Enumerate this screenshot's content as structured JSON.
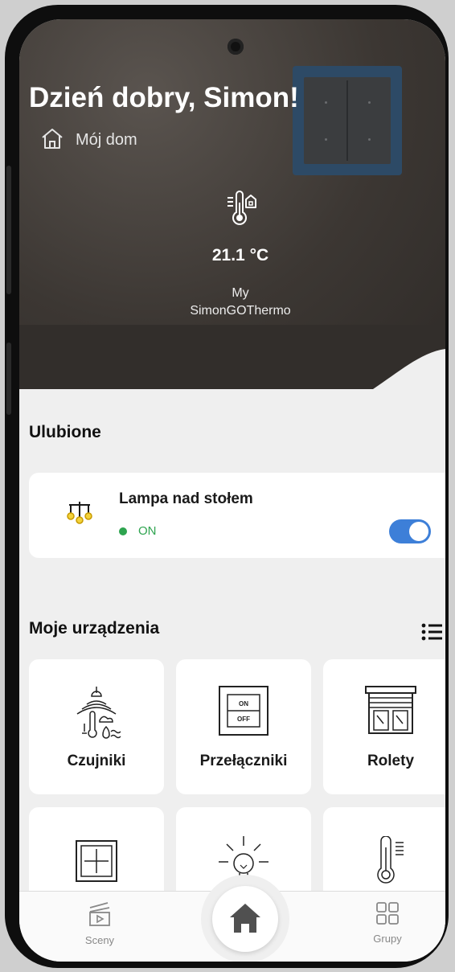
{
  "header": {
    "greeting": "Dzień dobry, Simon!",
    "home_label": "Mój dom",
    "temperature": "21.1 °C",
    "device_line1": "My",
    "device_line2": "SimonGOThermo"
  },
  "favorites": {
    "title": "Ulubione",
    "items": [
      {
        "name": "Lampa nad stołem",
        "status": "ON",
        "icon": "chandelier-icon",
        "toggle_on": true
      }
    ]
  },
  "devices": {
    "title": "Moje urządzenia",
    "tiles": [
      {
        "label": "Czujniki",
        "icon": "sensors-icon"
      },
      {
        "label": "Przełączniki",
        "icon": "switch-icon"
      },
      {
        "label": "Rolety",
        "icon": "blinds-icon"
      },
      {
        "label": "",
        "icon": "socket-frame-icon"
      },
      {
        "label": "",
        "icon": "bulb-icon"
      },
      {
        "label": "",
        "icon": "thermometer-icon"
      }
    ],
    "switch_on": "ON",
    "switch_off": "OFF"
  },
  "bottom_nav": {
    "scenes": "Sceny",
    "groups": "Grupy"
  },
  "colors": {
    "accent": "#3d7fd8",
    "status_on": "#2ea44f",
    "favorite_icon": "#e2b400"
  }
}
